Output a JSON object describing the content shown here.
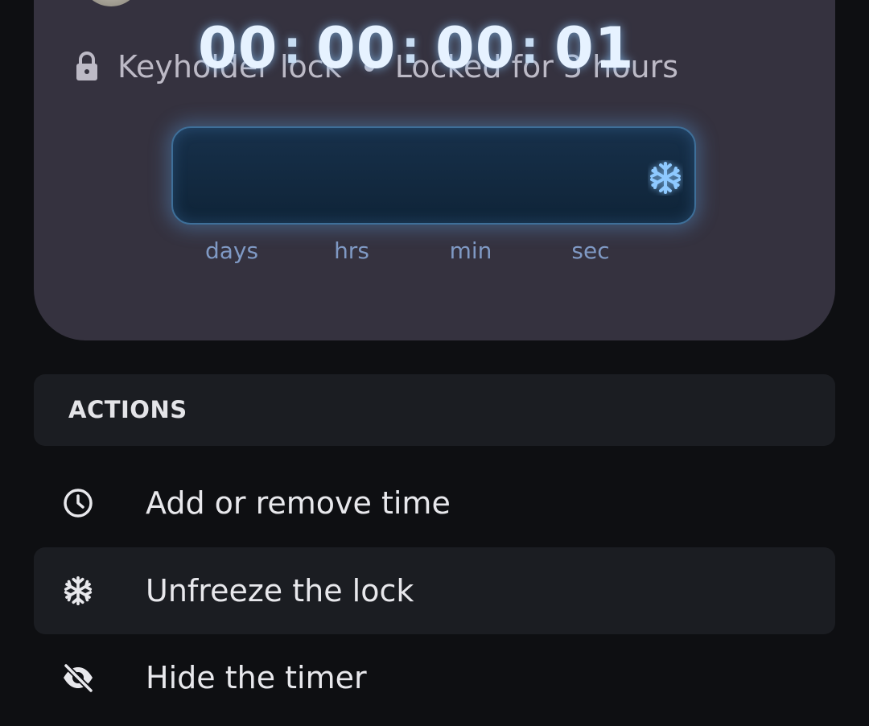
{
  "lock": {
    "type_label": "Keyholder lock",
    "duration_label": "Locked for 3 hours"
  },
  "timer": {
    "days": "00",
    "hours": "00",
    "minutes": "00",
    "seconds": "01",
    "separator": ":",
    "units": {
      "days": "days",
      "hours": "hrs",
      "minutes": "min",
      "seconds": "sec"
    },
    "status_icon": "snowflake-icon",
    "glow_color": "#5aa0e6"
  },
  "actions": {
    "title": "ACTIONS",
    "items": [
      {
        "label": "Add or remove time",
        "icon": "clock-icon"
      },
      {
        "label": "Unfreeze the lock",
        "icon": "snowflake-icon"
      },
      {
        "label": "Hide the timer",
        "icon": "eye-off-icon"
      }
    ]
  },
  "colors": {
    "background": "#0e0f12",
    "card": "#35323f",
    "panel": "#1b1d22",
    "accent": "#5aa0e6"
  }
}
